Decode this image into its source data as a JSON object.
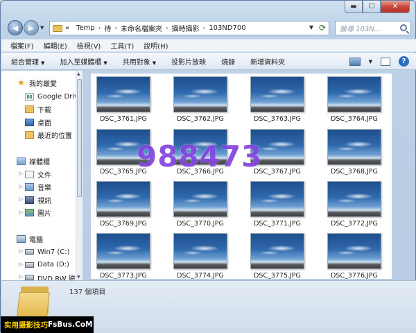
{
  "caption": {
    "minimize": "▬",
    "maximize": "☐",
    "close": "✕"
  },
  "nav": {
    "back": "◀",
    "forward": "▶",
    "breadcrumbs": [
      "«",
      "Temp",
      "待",
      "未命名檔案夾",
      "攝時攝影",
      "103ND700"
    ],
    "search_placeholder": "搜尋 103N..."
  },
  "menubar": [
    "檔案(F)",
    "編輯(E)",
    "檢視(V)",
    "工具(T)",
    "說明(H)"
  ],
  "commands": [
    {
      "label": "組合管理",
      "arrow": "▼"
    },
    {
      "label": "加入至媒體櫃",
      "arrow": "▼"
    },
    {
      "label": "共用對象",
      "arrow": "▼"
    },
    {
      "label": "投影片放映",
      "arrow": ""
    },
    {
      "label": "燒錄",
      "arrow": ""
    },
    {
      "label": "新增資料夾",
      "arrow": ""
    }
  ],
  "sidebar": {
    "favorites": {
      "label": "我的最愛",
      "icon": "star-icon"
    },
    "favorite_items": [
      {
        "label": "Google Drive",
        "icon": "google-drive-icon"
      },
      {
        "label": "下載",
        "icon": "folder-icon"
      },
      {
        "label": "桌面",
        "icon": "desktop-icon"
      },
      {
        "label": "最近的位置",
        "icon": "recent-icon"
      }
    ],
    "libraries": {
      "label": "媒體櫃",
      "icon": "library-icon"
    },
    "library_items": [
      {
        "label": "文件",
        "icon": "documents-icon"
      },
      {
        "label": "音樂",
        "icon": "music-icon"
      },
      {
        "label": "視訊",
        "icon": "video-icon"
      },
      {
        "label": "圖片",
        "icon": "pictures-icon"
      }
    ],
    "computer": {
      "label": "電腦",
      "icon": "computer-icon"
    },
    "computer_items": [
      {
        "label": "Win7 (C:)",
        "icon": "drive-icon"
      },
      {
        "label": "Data (D:)",
        "icon": "drive-icon"
      },
      {
        "label": "DVD RW 磁碟",
        "icon": "dvd-icon"
      }
    ]
  },
  "files": [
    "DSC_3761.JPG",
    "DSC_3762.JPG",
    "DSC_3763.JPG",
    "DSC_3764.JPG",
    "DSC_3765.JPG",
    "DSC_3766.JPG",
    "DSC_3767.JPG",
    "DSC_3768.JPG",
    "DSC_3769.JPG",
    "DSC_3770.JPG",
    "DSC_3771.JPG",
    "DSC_3772.JPG",
    "DSC_3773.JPG",
    "DSC_3774.JPG",
    "DSC_3775.JPG",
    "DSC_3776.JPG"
  ],
  "watermark": "988473",
  "details": {
    "item_count": "137 個項目"
  },
  "credit": {
    "text": "实用摄影技巧",
    "site": " FsBus.CoM"
  }
}
